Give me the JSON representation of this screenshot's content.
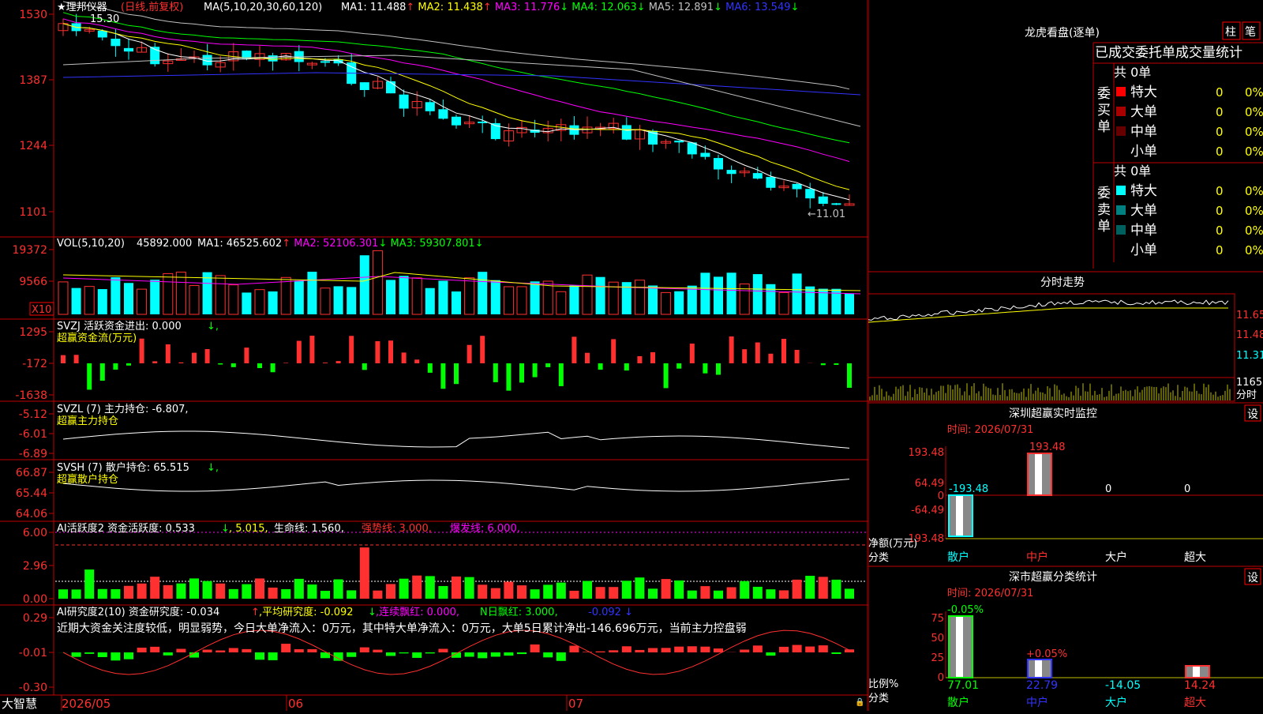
{
  "stock": {
    "title": "★理邦仪器",
    "period": "(日线,前复权)",
    "ma_label": "MA(5,10,20,30,60,120)",
    "ma": [
      {
        "label": "MA1: 11.488",
        "arrow": "↑",
        "color": "#ffffff"
      },
      {
        "label": "MA2: 11.438",
        "arrow": "↑",
        "color": "#ffff00"
      },
      {
        "label": "MA3: 11.776",
        "arrow": "↓",
        "color": "#ff00ff"
      },
      {
        "label": "MA4: 12.063",
        "arrow": "↓",
        "color": "#00ff00"
      },
      {
        "label": "MA5: 12.891",
        "arrow": "↓",
        "color": "#c0c0c0"
      },
      {
        "label": "MA6: 13.549",
        "arrow": "↓",
        "color": "#3333ff"
      }
    ],
    "y_ticks": [
      "1530",
      "1387",
      "1244",
      "1101"
    ],
    "high_label": "15.30",
    "low_label": "←11.01",
    "x_labels": [
      "2026/05",
      "06",
      "07"
    ],
    "brand": "大智慧"
  },
  "volume": {
    "label": "VOL(5,10,20)",
    "value": "45892.000",
    "ma": [
      {
        "label": "MA1: 46525.602",
        "arrow": "↑",
        "color": "#ffffff"
      },
      {
        "label": "MA2: 52106.301",
        "arrow": "↓",
        "color": "#ff00ff"
      },
      {
        "label": "MA3: 59307.801",
        "arrow": "↓",
        "color": "#00ff00"
      }
    ],
    "y_ticks": [
      "19372",
      "9566"
    ],
    "unit": "X10"
  },
  "svzj": {
    "label": "SVZJ  活跃资金进出: 0.000",
    "arrow": "↓,",
    "sub": "超赢资金流(万元)",
    "y_ticks": [
      "1295",
      "-172",
      "-1638"
    ]
  },
  "svzl": {
    "label": "SVZL (7) 主力持仓: -6.807,",
    "sub": "超赢主力持仓",
    "y_ticks": [
      "-5.12",
      "-6.01",
      "-6.89"
    ]
  },
  "svsh": {
    "label": "SVSH (7) 散户持仓: 65.515",
    "arrow": "↓,",
    "sub": "超赢散户持仓",
    "y_ticks": [
      "66.87",
      "65.44",
      "64.06"
    ]
  },
  "ai1": {
    "label": "AI活跃度2 资金活跃度: 0.533",
    "a1": "↓",
    "v2": ", 5.015,",
    "v3": "生命线: 1.560,",
    "v4": "强势线: 3.000,",
    "v5": "爆发线: 6.000,",
    "y_ticks": [
      "6.00",
      "2.96",
      "0.00"
    ]
  },
  "ai2": {
    "label": "AI研究度2(10) 资金研究度: -0.034",
    "a1": "↑",
    "v2": ",平均研究度: -0.092",
    "a2": "↓",
    "v3": ",连续飘红: 0.000,",
    "v4": "N日飘红: 3.000,",
    "v5": "-0.092",
    "a5": "↓",
    "summary": "近期大资金关注度较低，明显弱势，今日大单净流入：0万元，其中特大单净流入：0万元，大单5日累计净出-146.696万元，当前主力控盘弱",
    "y_ticks": [
      "0.29",
      "-0.01",
      "-0.30"
    ]
  },
  "longhu": {
    "title": "龙虎看盘(逐单)",
    "btn_zhu": "柱",
    "btn_bi": "笔",
    "header": "已成交委托单成交量统计",
    "buy_side": "委买单",
    "sell_side": "委卖单",
    "buy_total": "共 0单",
    "sell_total": "共 0单",
    "buy_rows": [
      {
        "name": "特大",
        "value": "0",
        "pct": "0%",
        "color": "#ff0000"
      },
      {
        "name": "大单",
        "value": "0",
        "pct": "0%",
        "color": "#aa0000"
      },
      {
        "name": "中单",
        "value": "0",
        "pct": "0%",
        "color": "#660000"
      },
      {
        "name": "小单",
        "value": "0",
        "pct": "0%",
        "color": ""
      }
    ],
    "sell_rows": [
      {
        "name": "特大",
        "value": "0",
        "pct": "0%",
        "color": "#00ffff"
      },
      {
        "name": "大单",
        "value": "0",
        "pct": "0%",
        "color": "#008080"
      },
      {
        "name": "中单",
        "value": "0",
        "pct": "0%",
        "color": "#006060"
      },
      {
        "name": "小单",
        "value": "0",
        "pct": "0%",
        "color": ""
      }
    ]
  },
  "fenshi": {
    "title": "分时走势",
    "y_ticks": [
      "11.65",
      "11.48",
      "11.31",
      "1165"
    ],
    "unit": "分时"
  },
  "monitor": {
    "title": "深圳超赢实时监控",
    "set": "设",
    "time": "时间: 2026/07/31",
    "y_ticks": [
      "193.48",
      "64.49",
      "0",
      "-64.49",
      "-193.48"
    ],
    "bar_labels": [
      "-193.48",
      "193.48",
      "0",
      "0"
    ],
    "y_caption": "净额(万元)",
    "x_caption": "分类",
    "categories": [
      "散户",
      "中户",
      "大户",
      "超大"
    ]
  },
  "classify": {
    "title": "深市超赢分类统计",
    "set": "设",
    "time": "时间: 2026/07/31",
    "y_ticks": [
      "75",
      "50",
      "25",
      "0"
    ],
    "top_labels": [
      "-0.05%",
      "+0.05%"
    ],
    "values": [
      "77.01",
      "22.79",
      "-14.05",
      "14.24"
    ],
    "y_caption": "比例%",
    "x_caption": "分类",
    "categories": [
      "散户",
      "中户",
      "大户",
      "超大"
    ]
  }
}
